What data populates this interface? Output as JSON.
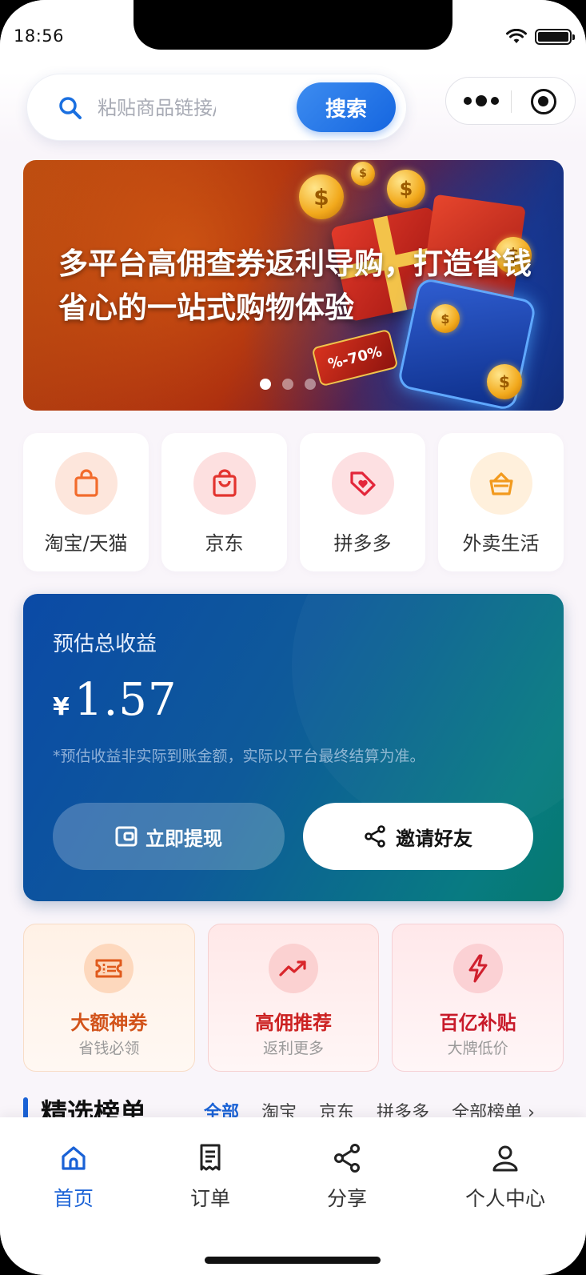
{
  "status": {
    "time": "18:56"
  },
  "search": {
    "placeholder": "粘贴商品链接/口令,",
    "button_label": "搜索"
  },
  "banner": {
    "headline": "多平台高佣查券返利导购，打造省钱省心的一站式购物体验",
    "tag_text": "%-70%",
    "slides": 3,
    "active_slide": 0
  },
  "platforms": [
    {
      "label": "淘宝/天猫",
      "icon": "shopping-bag-icon",
      "color": "#f26b2c",
      "bg": "#fde6dc"
    },
    {
      "label": "京东",
      "icon": "shopping-bag-icon",
      "color": "#e3342f",
      "bg": "#fde0e0"
    },
    {
      "label": "拼多多",
      "icon": "price-tag-heart-icon",
      "color": "#e3263a",
      "bg": "#fde0e2"
    },
    {
      "label": "外卖生活",
      "icon": "basket-icon",
      "color": "#f29a1e",
      "bg": "#fff0dc"
    }
  ],
  "earnings": {
    "title": "预估总收益",
    "currency": "¥",
    "amount": "1.57",
    "note": "*预估收益非实际到账金额，实际以平台最终结算为准。",
    "withdraw_label": "立即提现",
    "invite_label": "邀请好友"
  },
  "features": [
    {
      "title": "大额神券",
      "subtitle": "省钱必领",
      "icon": "ticket-icon"
    },
    {
      "title": "高佣推荐",
      "subtitle": "返利更多",
      "icon": "trend-up-icon"
    },
    {
      "title": "百亿补贴",
      "subtitle": "大牌低价",
      "icon": "lightning-icon"
    }
  ],
  "ranking": {
    "title": "精选榜单",
    "tabs": [
      "全部",
      "淘宝",
      "京东",
      "拼多多"
    ],
    "all_link": "全部榜单"
  },
  "tabbar": [
    {
      "label": "首页",
      "icon": "home-icon",
      "active": true
    },
    {
      "label": "订单",
      "icon": "receipt-icon",
      "active": false
    },
    {
      "label": "分享",
      "icon": "share-icon",
      "active": false
    },
    {
      "label": "个人中心",
      "icon": "user-icon",
      "active": false
    }
  ],
  "colors": {
    "accent": "#1a62d6",
    "earn_start": "#0b4aa6",
    "earn_end": "#057a6e"
  }
}
